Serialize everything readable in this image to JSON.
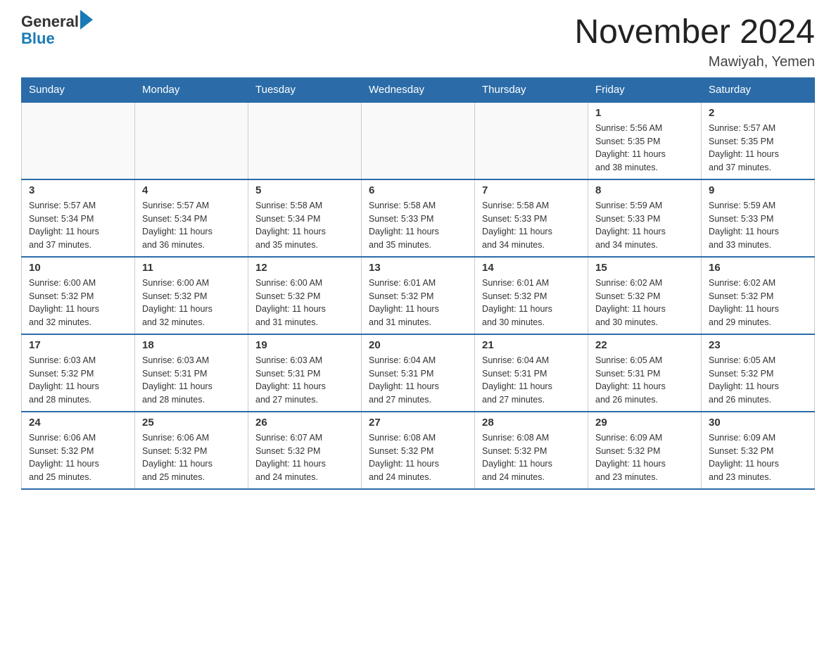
{
  "header": {
    "logo_general": "General",
    "logo_blue": "Blue",
    "month_title": "November 2024",
    "location": "Mawiyah, Yemen"
  },
  "days_of_week": [
    "Sunday",
    "Monday",
    "Tuesday",
    "Wednesday",
    "Thursday",
    "Friday",
    "Saturday"
  ],
  "weeks": [
    [
      {
        "day": "",
        "info": ""
      },
      {
        "day": "",
        "info": ""
      },
      {
        "day": "",
        "info": ""
      },
      {
        "day": "",
        "info": ""
      },
      {
        "day": "",
        "info": ""
      },
      {
        "day": "1",
        "info": "Sunrise: 5:56 AM\nSunset: 5:35 PM\nDaylight: 11 hours\nand 38 minutes."
      },
      {
        "day": "2",
        "info": "Sunrise: 5:57 AM\nSunset: 5:35 PM\nDaylight: 11 hours\nand 37 minutes."
      }
    ],
    [
      {
        "day": "3",
        "info": "Sunrise: 5:57 AM\nSunset: 5:34 PM\nDaylight: 11 hours\nand 37 minutes."
      },
      {
        "day": "4",
        "info": "Sunrise: 5:57 AM\nSunset: 5:34 PM\nDaylight: 11 hours\nand 36 minutes."
      },
      {
        "day": "5",
        "info": "Sunrise: 5:58 AM\nSunset: 5:34 PM\nDaylight: 11 hours\nand 35 minutes."
      },
      {
        "day": "6",
        "info": "Sunrise: 5:58 AM\nSunset: 5:33 PM\nDaylight: 11 hours\nand 35 minutes."
      },
      {
        "day": "7",
        "info": "Sunrise: 5:58 AM\nSunset: 5:33 PM\nDaylight: 11 hours\nand 34 minutes."
      },
      {
        "day": "8",
        "info": "Sunrise: 5:59 AM\nSunset: 5:33 PM\nDaylight: 11 hours\nand 34 minutes."
      },
      {
        "day": "9",
        "info": "Sunrise: 5:59 AM\nSunset: 5:33 PM\nDaylight: 11 hours\nand 33 minutes."
      }
    ],
    [
      {
        "day": "10",
        "info": "Sunrise: 6:00 AM\nSunset: 5:32 PM\nDaylight: 11 hours\nand 32 minutes."
      },
      {
        "day": "11",
        "info": "Sunrise: 6:00 AM\nSunset: 5:32 PM\nDaylight: 11 hours\nand 32 minutes."
      },
      {
        "day": "12",
        "info": "Sunrise: 6:00 AM\nSunset: 5:32 PM\nDaylight: 11 hours\nand 31 minutes."
      },
      {
        "day": "13",
        "info": "Sunrise: 6:01 AM\nSunset: 5:32 PM\nDaylight: 11 hours\nand 31 minutes."
      },
      {
        "day": "14",
        "info": "Sunrise: 6:01 AM\nSunset: 5:32 PM\nDaylight: 11 hours\nand 30 minutes."
      },
      {
        "day": "15",
        "info": "Sunrise: 6:02 AM\nSunset: 5:32 PM\nDaylight: 11 hours\nand 30 minutes."
      },
      {
        "day": "16",
        "info": "Sunrise: 6:02 AM\nSunset: 5:32 PM\nDaylight: 11 hours\nand 29 minutes."
      }
    ],
    [
      {
        "day": "17",
        "info": "Sunrise: 6:03 AM\nSunset: 5:32 PM\nDaylight: 11 hours\nand 28 minutes."
      },
      {
        "day": "18",
        "info": "Sunrise: 6:03 AM\nSunset: 5:31 PM\nDaylight: 11 hours\nand 28 minutes."
      },
      {
        "day": "19",
        "info": "Sunrise: 6:03 AM\nSunset: 5:31 PM\nDaylight: 11 hours\nand 27 minutes."
      },
      {
        "day": "20",
        "info": "Sunrise: 6:04 AM\nSunset: 5:31 PM\nDaylight: 11 hours\nand 27 minutes."
      },
      {
        "day": "21",
        "info": "Sunrise: 6:04 AM\nSunset: 5:31 PM\nDaylight: 11 hours\nand 27 minutes."
      },
      {
        "day": "22",
        "info": "Sunrise: 6:05 AM\nSunset: 5:31 PM\nDaylight: 11 hours\nand 26 minutes."
      },
      {
        "day": "23",
        "info": "Sunrise: 6:05 AM\nSunset: 5:32 PM\nDaylight: 11 hours\nand 26 minutes."
      }
    ],
    [
      {
        "day": "24",
        "info": "Sunrise: 6:06 AM\nSunset: 5:32 PM\nDaylight: 11 hours\nand 25 minutes."
      },
      {
        "day": "25",
        "info": "Sunrise: 6:06 AM\nSunset: 5:32 PM\nDaylight: 11 hours\nand 25 minutes."
      },
      {
        "day": "26",
        "info": "Sunrise: 6:07 AM\nSunset: 5:32 PM\nDaylight: 11 hours\nand 24 minutes."
      },
      {
        "day": "27",
        "info": "Sunrise: 6:08 AM\nSunset: 5:32 PM\nDaylight: 11 hours\nand 24 minutes."
      },
      {
        "day": "28",
        "info": "Sunrise: 6:08 AM\nSunset: 5:32 PM\nDaylight: 11 hours\nand 24 minutes."
      },
      {
        "day": "29",
        "info": "Sunrise: 6:09 AM\nSunset: 5:32 PM\nDaylight: 11 hours\nand 23 minutes."
      },
      {
        "day": "30",
        "info": "Sunrise: 6:09 AM\nSunset: 5:32 PM\nDaylight: 11 hours\nand 23 minutes."
      }
    ]
  ]
}
